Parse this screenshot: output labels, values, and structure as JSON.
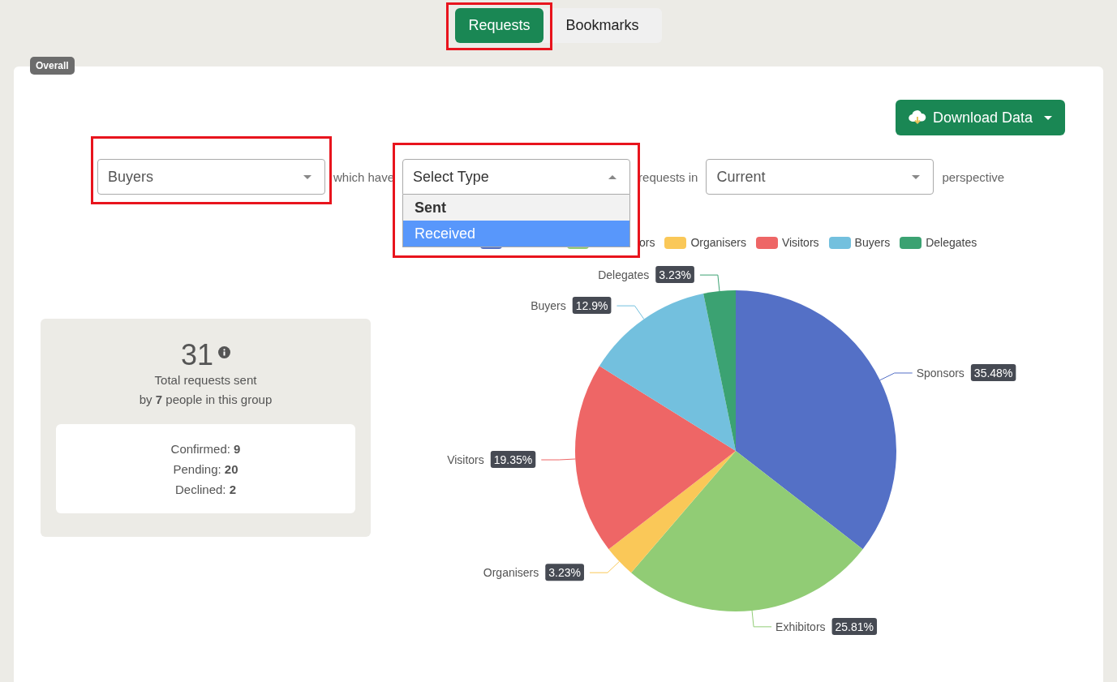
{
  "tabs": [
    {
      "label": "Requests",
      "selected": true,
      "highlighted": true
    },
    {
      "label": "Bookmarks",
      "selected": false,
      "highlighted": false
    }
  ],
  "panel": {
    "badge": "Overall",
    "download_button": "Download Data",
    "filters": [
      {
        "kind": "select",
        "value": "Buyers",
        "open": false,
        "highlighted": true
      },
      {
        "kind": "text",
        "text": "which have"
      },
      {
        "kind": "select",
        "placeholder": "Select Type",
        "open": true,
        "highlighted": true,
        "options": [
          {
            "label": "Sent",
            "selected": true,
            "highlighted": false
          },
          {
            "label": "Received",
            "selected": false,
            "highlighted": true
          }
        ]
      },
      {
        "kind": "text",
        "text": "requests in"
      },
      {
        "kind": "select",
        "value": "Current",
        "open": false,
        "highlighted": false
      },
      {
        "kind": "text",
        "text": "perspective"
      }
    ],
    "legend": [
      {
        "color": "#5470c6"
      },
      {
        "label": "ors",
        "color": "#91cc75"
      },
      {
        "label": "Organisers",
        "color": "#fac858"
      },
      {
        "label": "Visitors",
        "color": "#ee6666"
      },
      {
        "label": "Buyers",
        "color": "#73c0de"
      },
      {
        "label": "Delegates",
        "color": "#3ba272"
      }
    ],
    "summary": {
      "total": "31",
      "caption": "Total requests sent",
      "subcaption": "by **7** people in this group",
      "breakdown": [
        "Confirmed: **9**",
        "Pending: **20**",
        "Declined: **2**"
      ]
    },
    "chart_data": {
      "type": "pie",
      "categories": [
        "Sponsors",
        "Exhibitors",
        "Organisers",
        "Visitors",
        "Buyers",
        "Delegates"
      ],
      "values": [
        35.48,
        25.81,
        3.23,
        19.35,
        12.9,
        3.23
      ],
      "colors": [
        "#5470c6",
        "#91cc75",
        "#fac858",
        "#ee6666",
        "#73c0de",
        "#3ba272"
      ],
      "value_labels": [
        "35.48%",
        "25.81%",
        "3.23%",
        "19.35%",
        "12.9%",
        "3.23%"
      ]
    }
  }
}
